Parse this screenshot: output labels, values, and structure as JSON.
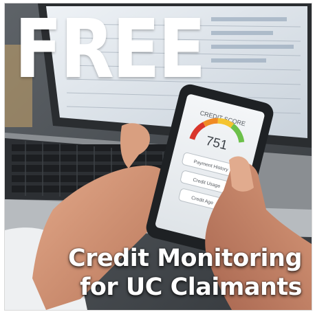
{
  "headline": "FREE",
  "caption": {
    "line1": "Credit Monitoring",
    "line2": "for UC Claimants"
  },
  "phone": {
    "title": "CREDIT SCORE",
    "score": "751",
    "buttons": [
      "Payment History",
      "Credit Usage",
      "Credit Age"
    ]
  },
  "colors": {
    "text": "#ffffff",
    "gauge_red": "#d9352b",
    "gauge_orange": "#f08a24",
    "gauge_yellow": "#f4c430",
    "gauge_green": "#6cc04a"
  }
}
